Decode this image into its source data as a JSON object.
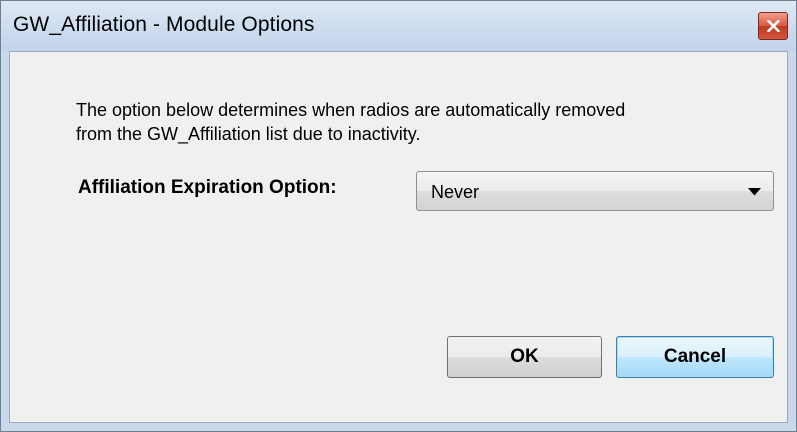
{
  "window": {
    "title": "GW_Affiliation - Module Options"
  },
  "dialog": {
    "description_line1": "The option below determines when radios are automatically removed",
    "description_line2": "from the GW_Affiliation list due to inactivity.",
    "expiration_label": "Affiliation Expiration Option:",
    "expiration_selected": "Never",
    "ok_label": "OK",
    "cancel_label": "Cancel"
  },
  "icons": {
    "close": "close-icon",
    "dropdown": "chevron-down-icon"
  },
  "colors": {
    "titlebar": "#cddcef",
    "close_button": "#d3553c",
    "client_background": "#f0f0f0",
    "focused_button_border": "#3c7fb1"
  }
}
